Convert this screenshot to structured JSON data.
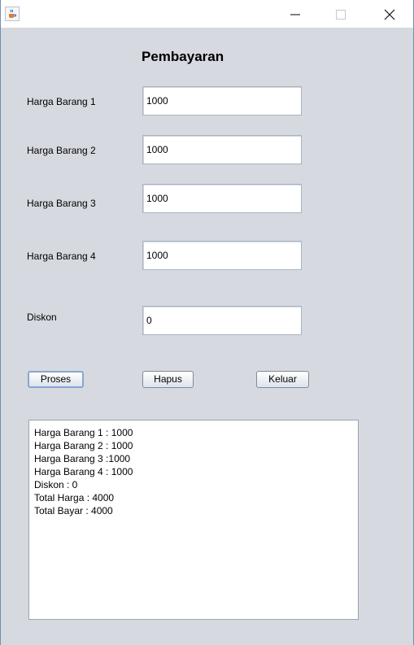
{
  "window": {
    "minimize_icon": "minimize-icon",
    "maximize_icon": "maximize-icon",
    "close_icon": "close-icon",
    "app_icon": "java-cup-icon"
  },
  "form": {
    "title": "Pembayaran",
    "fields": [
      {
        "label": "Harga Barang 1",
        "value": "1000"
      },
      {
        "label": "Harga Barang 2",
        "value": "1000"
      },
      {
        "label": "Harga Barang 3",
        "value": "1000"
      },
      {
        "label": "Harga Barang 4",
        "value": "1000"
      },
      {
        "label": "Diskon",
        "value": "0"
      }
    ],
    "buttons": {
      "proses": "Proses",
      "hapus": "Hapus",
      "keluar": "Keluar"
    }
  },
  "output": {
    "lines": [
      "Harga Barang 1 : 1000",
      "Harga Barang 2 : 1000",
      "Harga Barang 3 :1000",
      "Harga Barang 4 : 1000",
      "Diskon : 0",
      "Total Harga : 4000",
      "Total Bayar : 4000"
    ]
  }
}
